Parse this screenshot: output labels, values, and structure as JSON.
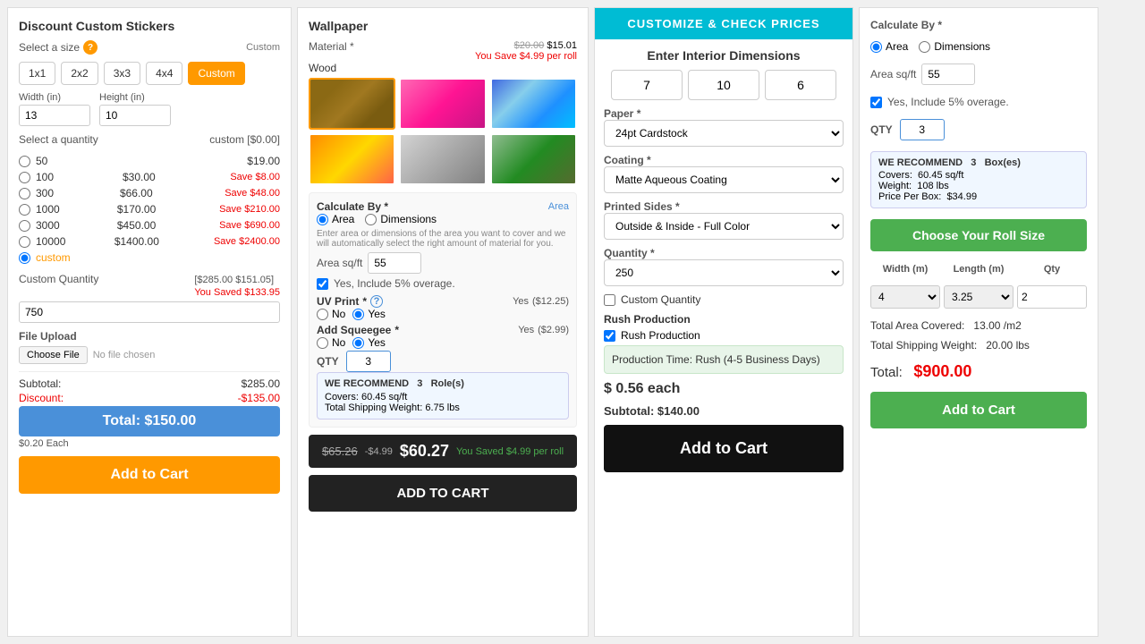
{
  "panel1": {
    "title": "Discount Custom Stickers",
    "size_label": "Select a size",
    "custom_tag": "Custom",
    "sizes": [
      "1x1",
      "2x2",
      "3x3",
      "4x4",
      "Custom"
    ],
    "active_size": "Custom",
    "width_label": "Width (in)",
    "height_label": "Height (in)",
    "width_value": "13",
    "height_value": "10",
    "qty_label": "Select a quantity",
    "qty_custom": "custom",
    "qty_price_custom": "[$0.00]",
    "quantities": [
      {
        "value": "50",
        "price": "$19.00",
        "save": null
      },
      {
        "value": "100",
        "price": "$30.00",
        "save": "Save $8.00"
      },
      {
        "value": "300",
        "price": "$66.00",
        "save": "Save $48.00"
      },
      {
        "value": "1000",
        "price": "$170.00",
        "save": "Save $210.00"
      },
      {
        "value": "3000",
        "price": "$450.00",
        "save": "Save $690.00"
      },
      {
        "value": "10000",
        "price": "$1400.00",
        "save": "Save $2400.00"
      }
    ],
    "custom_qty_label": "Custom Quantity",
    "custom_qty_prices": "[$285.00 $151.05]",
    "custom_qty_saved": "You Saved $133.95",
    "custom_qty_value": "750",
    "file_upload_label": "File Upload",
    "file_btn": "Choose File",
    "file_name": "No file chosen",
    "subtotal_label": "Subtotal:",
    "subtotal_value": "$285.00",
    "discount_label": "Discount:",
    "discount_value": "-$135.00",
    "total_label": "Total: $150.00",
    "each_label": "$0.20 Each",
    "add_to_cart": "Add to Cart"
  },
  "panel2": {
    "title": "Wallpaper",
    "material_label": "Material",
    "material_name": "Wood",
    "material_orig": "$20.00",
    "material_sale": "$15.01",
    "material_save": "You Save $4.99 per roll",
    "calc_by_label": "Calculate By",
    "calc_area": "Area",
    "calc_dimensions": "Dimensions",
    "calc_tag": "Area",
    "hint": "Enter area or dimensions of the area you want to cover and we will automatically select the right amount of material for you.",
    "area_label": "Area sq/ft",
    "area_value": "55",
    "overage_label": "Yes, Include 5% overage.",
    "uv_label": "UV Print",
    "uv_status": "Yes",
    "uv_price": "($12.25)",
    "uv_no": "No",
    "uv_yes": "Yes",
    "squeegee_label": "Add Squeegee",
    "squeegee_status": "Yes",
    "squeegee_price": "($2.99)",
    "squeegee_no": "No",
    "squeegee_yes": "Yes",
    "qty_label": "QTY",
    "qty_value": "3",
    "recommend_label": "WE RECOMMEND",
    "recommend_value": "3",
    "recommend_unit": "Role(s)",
    "covers_label": "Covers:",
    "covers_value": "60.45 sq/ft",
    "weight_label": "Total Shipping Weight:",
    "weight_value": "6.75 lbs",
    "orig_price": "$65.26",
    "discount_price": "-$4.99",
    "sale_price": "$60.27",
    "saved_tag": "You Saved $4.99 per roll",
    "add_to_cart": "ADD TO CART"
  },
  "panel3": {
    "header": "CUSTOMIZE & CHECK PRICES",
    "title": "Enter Interior Dimensions",
    "dim1": "7",
    "dim2": "10",
    "dim3": "6",
    "paper_label": "Paper",
    "paper_value": "24pt Cardstock",
    "coating_label": "Coating",
    "coating_value": "Matte Aqueous Coating",
    "printed_sides_label": "Printed Sides",
    "printed_sides_value": "Outside & Inside - Full Color",
    "quantity_label": "Quantity",
    "quantity_value": "250",
    "custom_qty_label": "Custom Quantity",
    "custom_qty_checked": false,
    "custom_qty_text": "Custom Quantity",
    "rush_label": "Rush Production",
    "rush_checked": true,
    "rush_text": "Rush Production",
    "rush_info": "Production Time: Rush (4-5 Business Days)",
    "price_each_label": "$ 0.56 each",
    "subtotal_label": "Subtotal: $140.00",
    "add_to_cart": "Add to Cart"
  },
  "panel4": {
    "calc_by_label": "Calculate By",
    "calc_area": "Area",
    "calc_dimensions": "Dimensions",
    "area_label": "Area sq/ft",
    "area_value": "55",
    "overage_label": "Yes, Include 5% overage.",
    "qty_label": "QTY",
    "qty_value": "3",
    "recommend_label": "WE RECOMMEND",
    "recommend_value": "3",
    "recommend_unit": "Box(es)",
    "covers_label": "Covers:",
    "covers_value": "60.45 sq/ft",
    "weight_label": "Weight:",
    "weight_value": "108 lbs",
    "price_per_box_label": "Price Per Box:",
    "price_per_box_value": "$34.99",
    "roll_header": "Choose Your Roll Size",
    "width_col": "Width (m)",
    "length_col": "Length (m)",
    "qty_col": "Qty",
    "width_val": "4",
    "length_val": "3.25",
    "qty_val": "2",
    "total_area_label": "Total Area Covered:",
    "total_area_value": "13.00",
    "total_area_unit": "/m2",
    "shipping_weight_label": "Total Shipping Weight:",
    "shipping_weight_value": "20.00 lbs",
    "total_label": "Total:",
    "total_price": "$900.00",
    "add_to_cart": "Add to Cart"
  }
}
